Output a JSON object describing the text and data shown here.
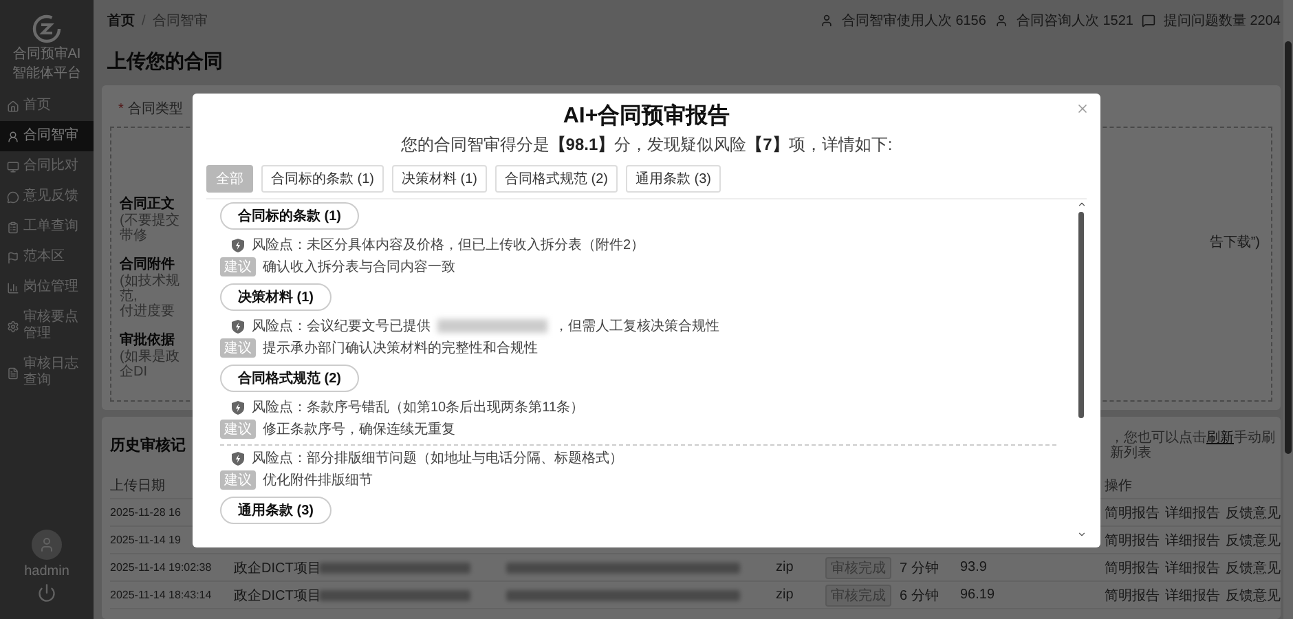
{
  "sidebar": {
    "brand": [
      "合同预审AI",
      "智能体平台"
    ],
    "items": [
      {
        "label": "首页",
        "selected": false
      },
      {
        "label": "合同智审",
        "selected": true
      },
      {
        "label": "合同比对",
        "selected": false
      },
      {
        "label": "意见反馈",
        "selected": false
      },
      {
        "label": "工单查询",
        "selected": false
      },
      {
        "label": "范本区",
        "selected": false
      },
      {
        "label": "岗位管理",
        "selected": false
      },
      {
        "label": "审核要点管理",
        "selected": false
      },
      {
        "label": "审核日志查询",
        "selected": false
      }
    ],
    "user": {
      "name": "hadmin"
    }
  },
  "header": {
    "breadcrumb": [
      "首页",
      "合同智审"
    ],
    "separator": "/",
    "stats": [
      {
        "label": "合同智审使用人次",
        "value": "6156"
      },
      {
        "label": "合同咨询人次",
        "value": "1521"
      },
      {
        "label": "提问问题数量",
        "value": "2204"
      }
    ]
  },
  "upload": {
    "title": "上传您的合同",
    "type_field": {
      "required_mark": "*",
      "label": "合同类型"
    },
    "blocks": [
      {
        "title": "合同正文",
        "hint": [
          "(不要提交带修"
        ]
      },
      {
        "title": "合同附件",
        "hint": [
          "(如技术规范,",
          "付进度要"
        ]
      },
      {
        "title": "审批依据",
        "hint": [
          "(如果是政企DI"
        ]
      }
    ],
    "note": "告下载”)"
  },
  "history": {
    "title": "历史审核记",
    "note": {
      "before": "，您也可以点击",
      "link": "刷新",
      "after": "手动刷新列表"
    },
    "columns": {
      "date": "上传日期",
      "actions": "操作"
    },
    "rows": [
      {
        "date": "2025-11-28 16",
        "actions": [
          "简明报告",
          "详细报告",
          "反馈意见"
        ]
      },
      {
        "date": "2025-11-14 19",
        "actions": [
          "简明报告",
          "详细报告",
          "反馈意见"
        ]
      },
      {
        "date": "2025-11-14 19:02:38",
        "type": "政企DICT项目",
        "redacted": true,
        "format": "zip",
        "status": "审核完成",
        "duration": "7 分钟",
        "score": "93.9",
        "actions": [
          "简明报告",
          "详细报告",
          "反馈意见"
        ]
      },
      {
        "date": "2025-11-14 18:43:14",
        "type": "政企DICT项目",
        "redacted": true,
        "format": "zip",
        "status": "审核完成",
        "duration": "6 分钟",
        "score": "96.19",
        "actions": [
          "简明报告",
          "详细报告",
          "反馈意见"
        ]
      }
    ]
  },
  "modal": {
    "title": "AI+合同预审报告",
    "summary": "您的合同智审得分是**【98.1】**分，发现疑似风险**【7】**项，详情如下:",
    "filters": [
      {
        "label": "全部",
        "selected": true
      },
      {
        "label": "合同标的条款 (1)",
        "selected": false
      },
      {
        "label": "决策材料 (1)",
        "selected": false
      },
      {
        "label": "合同格式规范 (2)",
        "selected": false
      },
      {
        "label": "通用条款 (3)",
        "selected": false
      }
    ],
    "groups": [
      {
        "title": "合同标的条款 (1)",
        "items": [
          {
            "risk": "风险点：未区分具体内容及价格，但已上传收入拆分表（附件2）",
            "advice_tag": "建议",
            "advice": "确认收入拆分表与合同内容一致"
          }
        ]
      },
      {
        "title": "决策材料 (1)",
        "items": [
          {
            "risk": "风险点：会议纪要文号已提供",
            "redacted": true,
            "risk_after": "，但需人工复核决策合规性",
            "advice_tag": "建议",
            "advice": "提示承办部门确认决策材料的完整性和合规性"
          }
        ]
      },
      {
        "title": "合同格式规范 (2)",
        "items": [
          {
            "risk": "风险点：条款序号错乱（如第10条后出现两条第11条）",
            "advice_tag": "建议",
            "advice": "修正条款序号，确保连续无重复"
          },
          {
            "risk": "风险点：部分排版细节问题（如地址与电话分隔、标题格式）",
            "advice_tag": "建议",
            "advice": "优化附件排版细节"
          }
        ]
      },
      {
        "title": "通用条款 (3)"
      }
    ]
  }
}
